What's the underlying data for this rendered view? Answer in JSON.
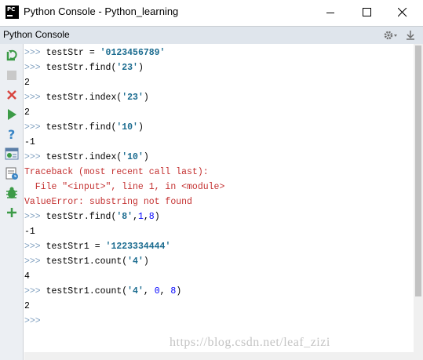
{
  "window": {
    "title": "Python Console - Python_learning",
    "icon_text": "PC"
  },
  "header": {
    "title": "Python Console",
    "gear_icon": "gear-icon",
    "pin_icon": "pin-icon"
  },
  "toolbar": [
    {
      "name": "rerun-icon",
      "tooltip": "Rerun"
    },
    {
      "name": "stop-icon",
      "tooltip": "Stop"
    },
    {
      "name": "close-icon",
      "tooltip": "Close"
    },
    {
      "name": "execute-icon",
      "tooltip": "Execute"
    },
    {
      "name": "help-icon",
      "tooltip": "Help"
    },
    {
      "name": "variables-icon",
      "tooltip": "Show Variables"
    },
    {
      "name": "history-icon",
      "tooltip": "History"
    },
    {
      "name": "debug-icon",
      "tooltip": "Attach Debugger"
    },
    {
      "name": "add-icon",
      "tooltip": "New Console"
    }
  ],
  "console": {
    "prompt": ">>>",
    "lines": [
      {
        "type": "cmd",
        "parts": [
          {
            "t": "testStr = "
          },
          {
            "t": "'0123456789'",
            "c": "str"
          }
        ]
      },
      {
        "type": "cmd",
        "parts": [
          {
            "t": "testStr.find("
          },
          {
            "t": "'23'",
            "c": "str"
          },
          {
            "t": ")"
          }
        ]
      },
      {
        "type": "out",
        "text": "2"
      },
      {
        "type": "cmd",
        "parts": [
          {
            "t": "testStr.index("
          },
          {
            "t": "'23'",
            "c": "str"
          },
          {
            "t": ")"
          }
        ]
      },
      {
        "type": "out",
        "text": "2"
      },
      {
        "type": "cmd",
        "parts": [
          {
            "t": "testStr.find("
          },
          {
            "t": "'10'",
            "c": "str"
          },
          {
            "t": ")"
          }
        ]
      },
      {
        "type": "out",
        "text": "-1"
      },
      {
        "type": "cmd",
        "parts": [
          {
            "t": "testStr.index("
          },
          {
            "t": "'10'",
            "c": "str"
          },
          {
            "t": ")"
          }
        ]
      },
      {
        "type": "err",
        "text": "Traceback (most recent call last):"
      },
      {
        "type": "err",
        "text": "  File \"<input>\", line 1, in <module>"
      },
      {
        "type": "err",
        "text": "ValueError: substring not found"
      },
      {
        "type": "cmd",
        "parts": [
          {
            "t": "testStr.find("
          },
          {
            "t": "'8'",
            "c": "str"
          },
          {
            "t": ","
          },
          {
            "t": "1",
            "c": "num"
          },
          {
            "t": ","
          },
          {
            "t": "8",
            "c": "num"
          },
          {
            "t": ")"
          }
        ]
      },
      {
        "type": "out",
        "text": "-1"
      },
      {
        "type": "cmd",
        "parts": [
          {
            "t": "testStr1 = "
          },
          {
            "t": "'1223334444'",
            "c": "str"
          }
        ]
      },
      {
        "type": "cmd",
        "parts": [
          {
            "t": "testStr1.count("
          },
          {
            "t": "'4'",
            "c": "str"
          },
          {
            "t": ")"
          }
        ]
      },
      {
        "type": "out",
        "text": "4"
      },
      {
        "type": "cmd",
        "parts": [
          {
            "t": "testStr1.count("
          },
          {
            "t": "'4'",
            "c": "str"
          },
          {
            "t": ", "
          },
          {
            "t": "0",
            "c": "num"
          },
          {
            "t": ", "
          },
          {
            "t": "8",
            "c": "num"
          },
          {
            "t": ")"
          }
        ]
      },
      {
        "type": "out",
        "text": "2"
      },
      {
        "type": "cmd",
        "parts": []
      }
    ]
  },
  "watermark": "https://blog.csdn.net/leaf_zizi",
  "colors": {
    "prompt": "#7f9fbf",
    "string": "#1a6b8f",
    "number": "#0000ff",
    "error": "#c43131",
    "header_bg": "#dfe5ec"
  }
}
